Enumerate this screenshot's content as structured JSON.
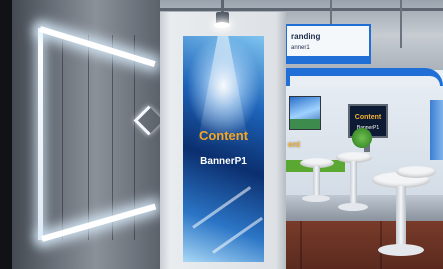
{
  "main_banner": {
    "title": "Content",
    "subtitle": "BannerP1"
  },
  "top_sign": {
    "title": "randing",
    "subtitle": "anner1"
  },
  "content_monitor": {
    "title": "Content",
    "subtitle": "BannerP1"
  },
  "side_text": {
    "content": "ent"
  },
  "colors": {
    "accent_orange": "#f5a623",
    "booth_blue": "#1f6fd6",
    "floor": "#6a3322"
  }
}
